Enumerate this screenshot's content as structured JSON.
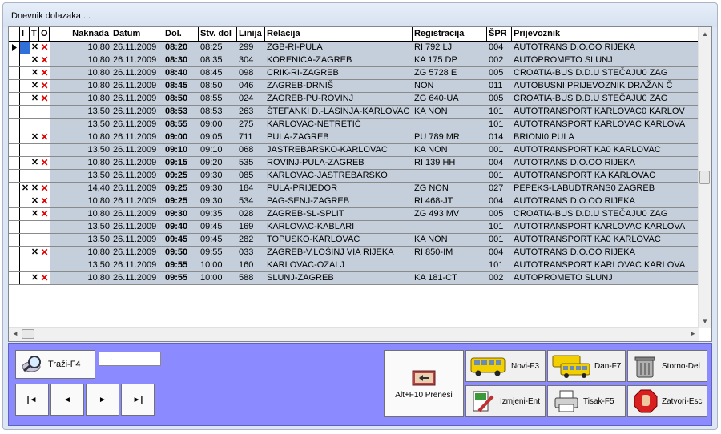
{
  "window": {
    "title": "Dnevnik dolazaka ..."
  },
  "columns": [
    "I",
    "T",
    "O",
    "Naknada",
    "Datum",
    "Dol.",
    "Stv. dol",
    "Linija",
    "Relacija",
    "Registracija",
    "ŠPR",
    "Prijevoznik"
  ],
  "rows": [
    {
      "i": "",
      "t": "✕",
      "o": "✕",
      "naknada": "10,80",
      "datum": "26.11.2009",
      "dol": "08:20",
      "stv": "08:25",
      "linija": "299",
      "relacija": "ZGB-RI-PULA",
      "reg": "RI 792 LJ",
      "spr": "004",
      "prijevoznik": "AUTOTRANS D.O.OO RIJEKA"
    },
    {
      "i": "",
      "t": "✕",
      "o": "✕",
      "naknada": "10,80",
      "datum": "26.11.2009",
      "dol": "08:30",
      "stv": "08:35",
      "linija": "304",
      "relacija": "KORENICA-ZAGREB",
      "reg": "KA 175 DP",
      "spr": "002",
      "prijevoznik": "AUTOPROMETO SLUNJ"
    },
    {
      "i": "",
      "t": "✕",
      "o": "✕",
      "naknada": "10,80",
      "datum": "26.11.2009",
      "dol": "08:40",
      "stv": "08:45",
      "linija": "098",
      "relacija": "CRIK-RI-ZAGREB",
      "reg": "ZG 5728 E",
      "spr": "005",
      "prijevoznik": "CROATIA-BUS D.D.U STEČAJU0 ZAG"
    },
    {
      "i": "",
      "t": "✕",
      "o": "✕",
      "naknada": "10,80",
      "datum": "26.11.2009",
      "dol": "08:45",
      "stv": "08:50",
      "linija": "046",
      "relacija": "ZAGREB-DRNIŠ",
      "reg": "NON",
      "spr": "011",
      "prijevoznik": "AUTOBUSNI PRIJEVOZNIK DRAŽAN Č"
    },
    {
      "i": "",
      "t": "✕",
      "o": "✕",
      "naknada": "10,80",
      "datum": "26.11.2009",
      "dol": "08:50",
      "stv": "08:55",
      "linija": "024",
      "relacija": "ZAGREB-PU-ROVINJ",
      "reg": "ZG 640-UA",
      "spr": "005",
      "prijevoznik": "CROATIA-BUS D.D.U STEČAJU0 ZAG"
    },
    {
      "i": "",
      "t": "",
      "o": "",
      "naknada": "13,50",
      "datum": "26.11.2009",
      "dol": "08:53",
      "stv": "08:53",
      "linija": "263",
      "relacija": "ŠTEFANKI D.-LASINJA-KARLOVAC",
      "reg": "KA NON",
      "spr": "101",
      "prijevoznik": "AUTOTRANSPORT KARLOVAC0 KARLOV"
    },
    {
      "i": "",
      "t": "",
      "o": "",
      "naknada": "13,50",
      "datum": "26.11.2009",
      "dol": "08:55",
      "stv": "09:00",
      "linija": "275",
      "relacija": "KARLOVAC-NETRETIĆ",
      "reg": "",
      "spr": "101",
      "prijevoznik": "AUTOTRANSPORT KARLOVAC KARLOVA"
    },
    {
      "i": "",
      "t": "✕",
      "o": "✕",
      "naknada": "10,80",
      "datum": "26.11.2009",
      "dol": "09:00",
      "stv": "09:05",
      "linija": "711",
      "relacija": "PULA-ZAGREB",
      "reg": "PU 789 MR",
      "spr": "014",
      "prijevoznik": "BRIONI0 PULA"
    },
    {
      "i": "",
      "t": "",
      "o": "",
      "naknada": "13,50",
      "datum": "26.11.2009",
      "dol": "09:10",
      "stv": "09:10",
      "linija": "068",
      "relacija": "JASTREBARSKO-KARLOVAC",
      "reg": "KA NON",
      "spr": "001",
      "prijevoznik": "AUTOTRANSPORT KA0 KARLOVAC"
    },
    {
      "i": "",
      "t": "✕",
      "o": "✕",
      "naknada": "10,80",
      "datum": "26.11.2009",
      "dol": "09:15",
      "stv": "09:20",
      "linija": "535",
      "relacija": "ROVINJ-PULA-ZAGREB",
      "reg": "RI 139 HH",
      "spr": "004",
      "prijevoznik": "AUTOTRANS D.O.OO RIJEKA"
    },
    {
      "i": "",
      "t": "",
      "o": "",
      "naknada": "13,50",
      "datum": "26.11.2009",
      "dol": "09:25",
      "stv": "09:30",
      "linija": "085",
      "relacija": "KARLOVAC-JASTREBARSKO",
      "reg": "",
      "spr": "001",
      "prijevoznik": "AUTOTRANSPORT KA KARLOVAC"
    },
    {
      "i": "✕",
      "t": "✕",
      "o": "✕",
      "naknada": "14,40",
      "datum": "26.11.2009",
      "dol": "09:25",
      "stv": "09:30",
      "linija": "184",
      "relacija": "PULA-PRIJEDOR",
      "reg": "ZG NON",
      "spr": "027",
      "prijevoznik": "PEPEKS-LABUDTRANS0 ZAGREB"
    },
    {
      "i": "",
      "t": "✕",
      "o": "✕",
      "naknada": "10,80",
      "datum": "26.11.2009",
      "dol": "09:25",
      "stv": "09:30",
      "linija": "534",
      "relacija": "PAG-SENJ-ZAGREB",
      "reg": "RI 468-JT",
      "spr": "004",
      "prijevoznik": "AUTOTRANS D.O.OO RIJEKA"
    },
    {
      "i": "",
      "t": "✕",
      "o": "✕",
      "naknada": "10,80",
      "datum": "26.11.2009",
      "dol": "09:30",
      "stv": "09:35",
      "linija": "028",
      "relacija": "ZAGREB-SL-SPLIT",
      "reg": "ZG 493 MV",
      "spr": "005",
      "prijevoznik": "CROATIA-BUS D.D.U STEČAJU0 ZAG"
    },
    {
      "i": "",
      "t": "",
      "o": "",
      "naknada": "13,50",
      "datum": "26.11.2009",
      "dol": "09:40",
      "stv": "09:45",
      "linija": "169",
      "relacija": "KARLOVAC-KABLARI",
      "reg": "",
      "spr": "101",
      "prijevoznik": "AUTOTRANSPORT KARLOVAC KARLOVA"
    },
    {
      "i": "",
      "t": "",
      "o": "",
      "naknada": "13,50",
      "datum": "26.11.2009",
      "dol": "09:45",
      "stv": "09:45",
      "linija": "282",
      "relacija": "TOPUSKO-KARLOVAC",
      "reg": "KA NON",
      "spr": "001",
      "prijevoznik": "AUTOTRANSPORT KA0 KARLOVAC"
    },
    {
      "i": "",
      "t": "✕",
      "o": "✕",
      "naknada": "10,80",
      "datum": "26.11.2009",
      "dol": "09:50",
      "stv": "09:55",
      "linija": "033",
      "relacija": "ZAGREB-V.LOŠINJ VIA RIJEKA",
      "reg": "RI 850-IM",
      "spr": "004",
      "prijevoznik": "AUTOTRANS D.O.OO RIJEKA"
    },
    {
      "i": "",
      "t": "",
      "o": "",
      "naknada": "13,50",
      "datum": "26.11.2009",
      "dol": "09:55",
      "stv": "10:00",
      "linija": "160",
      "relacija": "KARLOVAC-OZALJ",
      "reg": "",
      "spr": "101",
      "prijevoznik": "AUTOTRANSPORT KARLOVAC KARLOVA"
    },
    {
      "i": "",
      "t": "✕",
      "o": "✕",
      "naknada": "10,80",
      "datum": "26.11.2009",
      "dol": "09:55",
      "stv": "10:00",
      "linija": "588",
      "relacija": "SLUNJ-ZAGREB",
      "reg": "KA 181-CT",
      "spr": "002",
      "prijevoznik": "AUTOPROMETO SLUNJ"
    }
  ],
  "search": {
    "label": "Traži-F4",
    "value": ". ."
  },
  "nav": {
    "first": "|◄",
    "prev": "◄",
    "next": "►",
    "last": "►|"
  },
  "actions": {
    "prenesi": "Alt+F10 Prenesi",
    "novi": "Novi-F3",
    "dan": "Dan-F7",
    "storno": "Storno-Del",
    "izmjeni": "Izmjeni-Ent",
    "tisak": "Tisak-F5",
    "zatvori": "Zatvori-Esc"
  },
  "colors": {
    "row_bg": "#c5cfdb",
    "x_red": "#e00000",
    "panel": "#8b8bff"
  }
}
